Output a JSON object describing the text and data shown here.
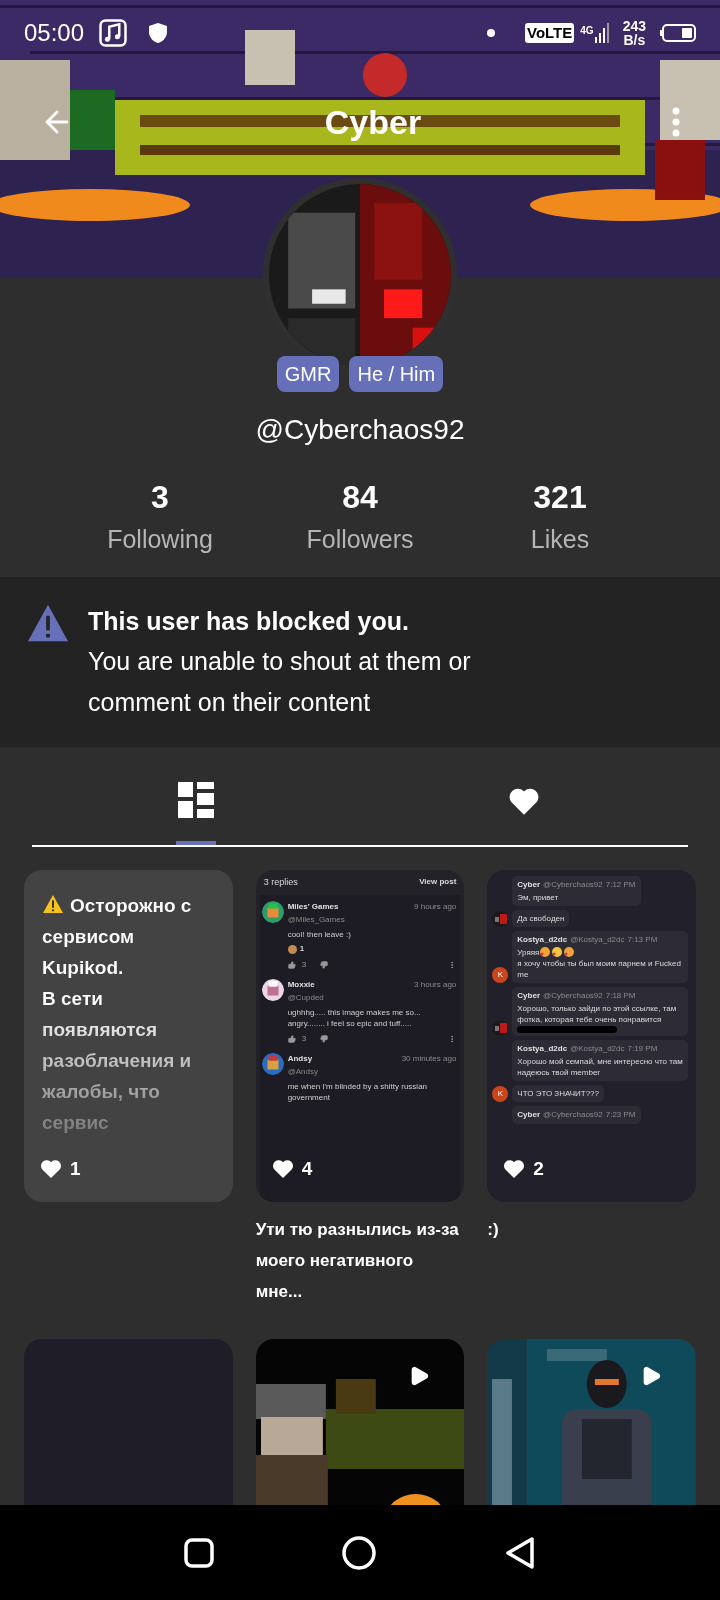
{
  "status_bar": {
    "time": "05:00",
    "network": "VoLTE",
    "generation": "4G",
    "speed": "243",
    "speed_unit": "B/s"
  },
  "header": {
    "title": "Cyber"
  },
  "profile": {
    "badges": [
      {
        "label": "GMR"
      },
      {
        "label": "He / Him"
      }
    ],
    "username": "@Cyberchaos92"
  },
  "stats": [
    {
      "value": "3",
      "label": "Following"
    },
    {
      "value": "84",
      "label": "Followers"
    },
    {
      "value": "321",
      "label": "Likes"
    }
  ],
  "notice": {
    "title": "This user has blocked you.",
    "message": "You are unable to shout at them or comment on their content"
  },
  "tabs": [
    {
      "kind": "grid",
      "selected": true
    },
    {
      "kind": "heart",
      "selected": false
    }
  ],
  "posts": [
    {
      "kind": "text",
      "text": "Осторожно с сервисом Kupikod.\nВ сети появляются разоблачения и жалобы, что сервис",
      "likes": "1"
    },
    {
      "kind": "comments",
      "likes": "4",
      "caption": "Ути тю разнылись из-за моего негативного мне...",
      "replies": "3 replies",
      "view": "View post",
      "comments": [
        {
          "name": "Miles' Games",
          "handle": "@Miles_Games",
          "time": "9 hours ago",
          "text": "cool! then leave :)",
          "reaction": "1",
          "votes": "3"
        },
        {
          "name": "Moxxie",
          "handle": "@Cupded",
          "time": "3 hours ago",
          "text": "ughhhg..... this image makes me so... angry........ i feel so epic and tuff.....",
          "votes": "3"
        },
        {
          "name": "Andsy",
          "handle": "@Andsy",
          "time": "30 minutes ago",
          "text": "me when I'm blinded by a shitty russian government"
        }
      ]
    },
    {
      "kind": "chat",
      "likes": "2",
      "caption": ":)",
      "messages": [
        {
          "kind": "plain",
          "author": "Cyber",
          "handle": "@Cyberchaos92",
          "time": "7:12 PM",
          "text": "Эм, привет"
        },
        {
          "kind": "picture",
          "text": "Да свободен"
        },
        {
          "kind": "letter",
          "letter": "K",
          "author": "Kostya_d2dc",
          "handle": "@Kostya_d2dc",
          "time": "7:13 PM",
          "text": "Уряяя",
          "emoji": [
            {
              "kind": "hearts"
            },
            {
              "kind": "kiss"
            },
            {
              "kind": "hearts"
            }
          ],
          "text_after": "я хочу чтобы ты был моим парнем и Fucked me"
        },
        {
          "kind": "picture",
          "author": "Cyber",
          "handle": "@Cyberchaos92",
          "time": "7:18 PM",
          "text": "Хорошо, только зайди по этой ссылке, там фотка, которая тебе очень понравится",
          "redacted": true
        },
        {
          "kind": "plain",
          "author": "Kostya_d2dc",
          "handle": "@Kostya_d2dc",
          "time": "7:19 PM",
          "text": "Хорошо мой семпай, мне интересно что там надеюсь твой member"
        },
        {
          "kind": "letter",
          "letter": "K",
          "text": "ЧТО ЭТО ЗНАЧИТ???"
        },
        {
          "kind": "plain",
          "author": "Cyber",
          "handle": "@Cyberchaos92",
          "time": "7:23 PM"
        }
      ]
    },
    {
      "kind": "empty"
    },
    {
      "kind": "video"
    },
    {
      "kind": "video"
    }
  ]
}
